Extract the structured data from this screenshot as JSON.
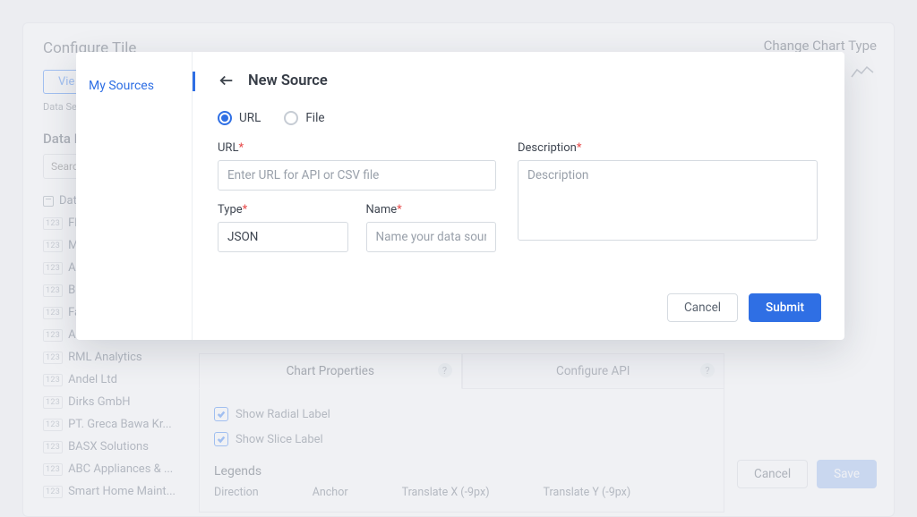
{
  "backdrop": {
    "title": "Configure Tile",
    "right_title": "Change Chart Type",
    "view_btn": "Vie",
    "dataset_label": "Data Set :",
    "fields_heading": "Data Fi",
    "search_placeholder": "Search",
    "cancel": "Cancel",
    "save": "Save"
  },
  "fields": [
    {
      "type": "date",
      "label": "Date"
    },
    {
      "type": "123",
      "label": "Fleet"
    },
    {
      "type": "123",
      "label": "Midc"
    },
    {
      "type": "123",
      "label": "Auto"
    },
    {
      "type": "123",
      "label": "Broo"
    },
    {
      "type": "123",
      "label": "Fanc"
    },
    {
      "type": "123",
      "label": "Auro"
    },
    {
      "type": "123",
      "label": "RML Analytics"
    },
    {
      "type": "123",
      "label": "Andel Ltd"
    },
    {
      "type": "123",
      "label": "Dirks GmbH"
    },
    {
      "type": "123",
      "label": "PT. Greca Bawa Kr..."
    },
    {
      "type": "123",
      "label": "BASX Solutions"
    },
    {
      "type": "123",
      "label": "ABC Appliances & ..."
    },
    {
      "type": "123",
      "label": "Smart Home Maint..."
    }
  ],
  "props": {
    "tab_a": "Chart Properties",
    "tab_b": "Configure API",
    "radial": "Show Radial Label",
    "slice": "Show Slice Label",
    "legends": "Legends",
    "c1": "Direction",
    "c2": "Anchor",
    "c3": "Translate X (-9px)",
    "c4": "Translate Y (-9px)"
  },
  "modal": {
    "side_item": "My Sources",
    "title": "New Source",
    "radio_url": "URL",
    "radio_file": "File",
    "url_label": "URL",
    "url_placeholder": "Enter URL for API or CSV file",
    "type_label": "Type",
    "type_value": "JSON",
    "name_label": "Name",
    "name_placeholder": "Name your data source",
    "desc_label": "Description",
    "desc_placeholder": "Description",
    "cancel": "Cancel",
    "submit": "Submit"
  }
}
